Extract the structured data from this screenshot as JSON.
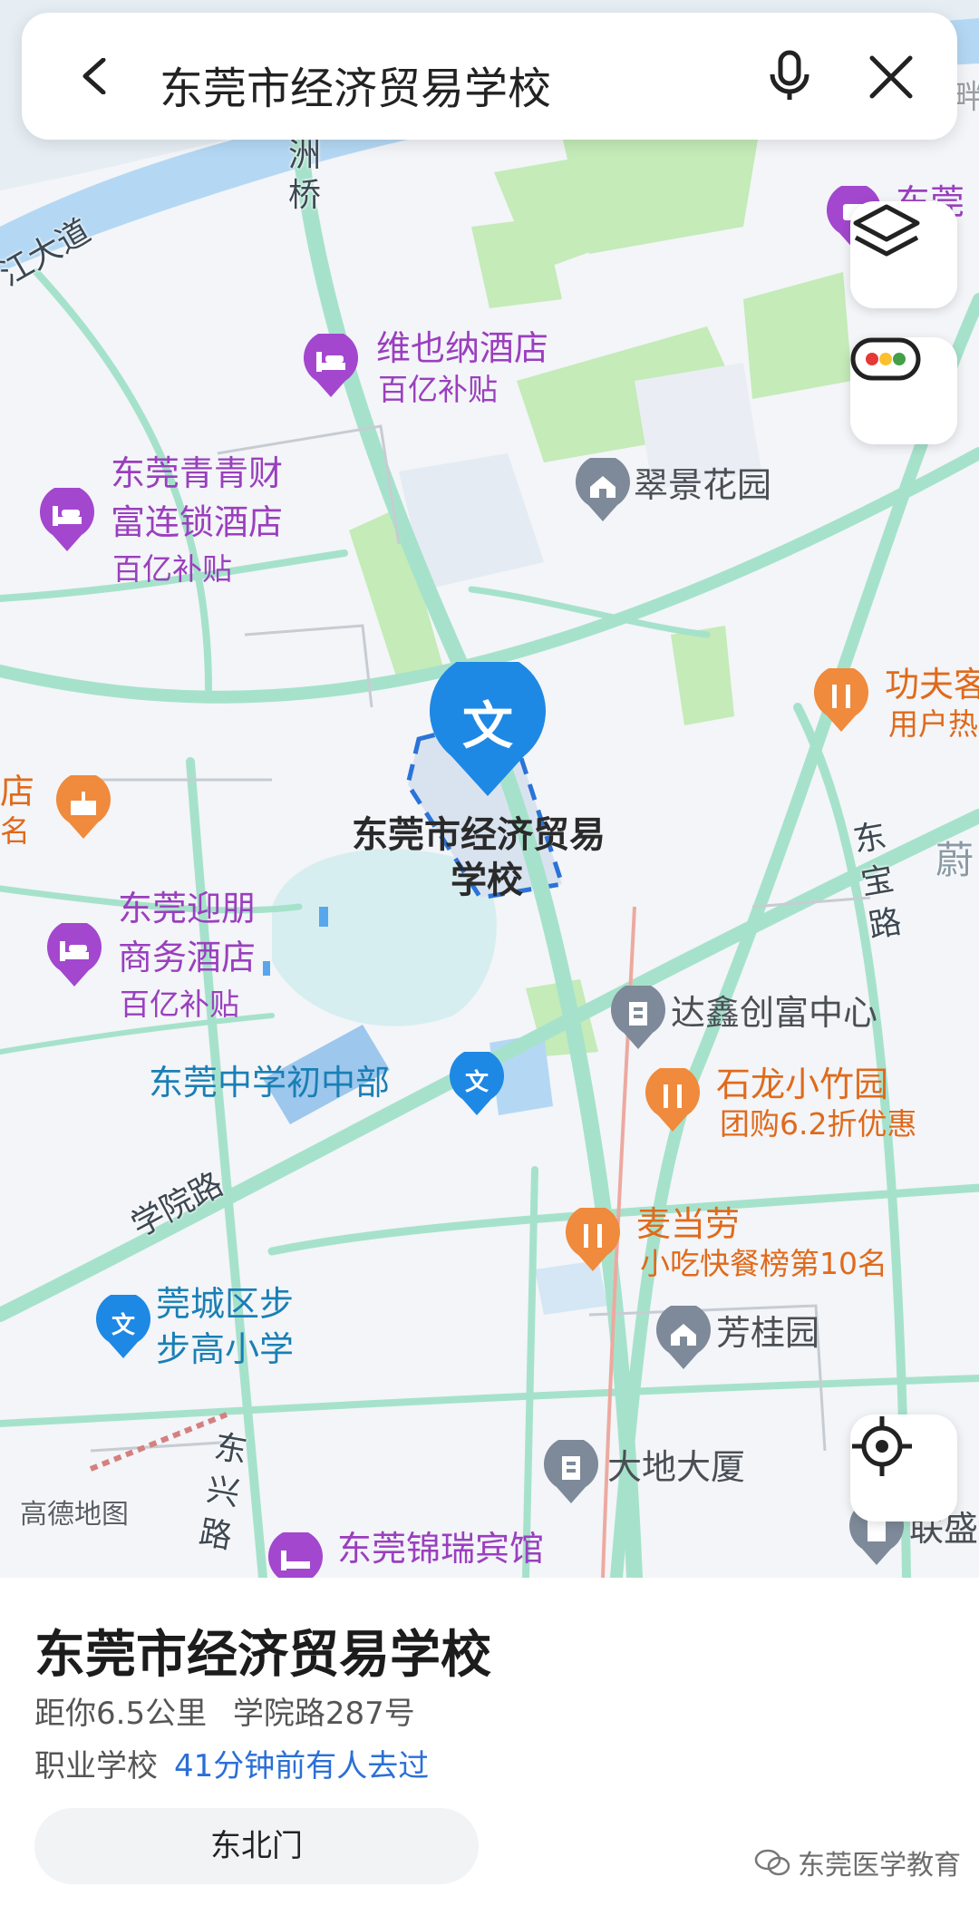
{
  "search": {
    "query": "东莞市经济贸易学校"
  },
  "map_labels": {
    "roads": {
      "jiang_dadao": "江大道",
      "zhou_qiao": "洲桥",
      "xueyuan_lu": "学院路",
      "dongbao_lu": "东宝路",
      "dongxing_lu": "东兴路"
    },
    "edge_top_right": "东莞",
    "edge_left": "店",
    "edge_left_sub": "名",
    "edge_right": "蔚",
    "edge_right_top": "畔",
    "pois": {
      "weiyena": {
        "name": "维也纳酒店",
        "sub": "百亿补贴"
      },
      "qingqing": {
        "name1": "东莞青青财",
        "name2": "富连锁酒店",
        "sub": "百亿补贴"
      },
      "cuijing": {
        "name": "翠景花园"
      },
      "gongfu": {
        "name": "功夫客",
        "sub": "用户热"
      },
      "school": {
        "name1": "东莞市经济贸易",
        "name2": "学校",
        "glyph": "文"
      },
      "yingpeng": {
        "name1": "东莞迎朋",
        "name2": "商务酒店",
        "sub": "百亿补贴"
      },
      "daxin": {
        "name": "达鑫创富中心"
      },
      "middle": {
        "name": "东莞中学初中部"
      },
      "shilong": {
        "name": "石龙小竹园",
        "sub": "团购6.2折优惠"
      },
      "mcd": {
        "name": "麦当劳",
        "sub": "小吃快餐榜第10名"
      },
      "guancheng": {
        "name1": "莞城区步",
        "name2": "步高小学"
      },
      "fanggui": {
        "name": "芳桂园"
      },
      "dadi": {
        "name": "大地大厦"
      },
      "jinrui": {
        "name": "东莞锦瑞宾馆"
      },
      "liansheng": {
        "name": "联盛"
      }
    },
    "logo": "高德地图"
  },
  "sheet": {
    "title": "东莞市经济贸易学校",
    "distance": "距你6.5公里",
    "address": "学院路287号",
    "category": "职业学校",
    "recent": "41分钟前有人去过",
    "gate": "东北门"
  },
  "watermark": "东莞医学教育",
  "colors": {
    "water": "#b4d8f4",
    "green": "#c4ebb8",
    "road": "#9fe0c6",
    "purple": "#a347cf",
    "orange": "#f08a3c",
    "blue": "#1e88e5"
  }
}
